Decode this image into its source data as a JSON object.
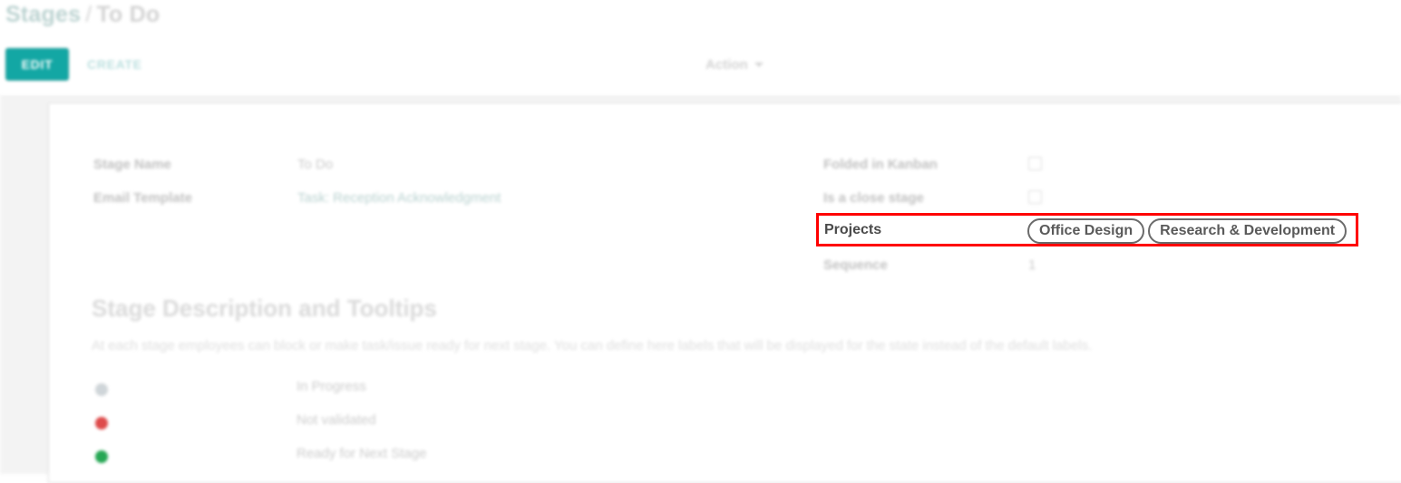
{
  "breadcrumb": {
    "root": "Stages",
    "separator": "/",
    "current": "To Do"
  },
  "control_panel": {
    "edit_label": "EDIT",
    "create_label": "CREATE",
    "action_label": "Action",
    "caret_icon": "chevron-down-icon"
  },
  "form": {
    "left_column": [
      {
        "label": "Stage Name",
        "value": "To Do",
        "style": "text"
      },
      {
        "label": "Email Template",
        "value": "Task: Reception Acknowledgment",
        "style": "link"
      }
    ],
    "right_column": [
      {
        "label": "Folded in Kanban",
        "value": "",
        "style": "checkbox",
        "checked": false
      },
      {
        "label": "Is a close stage",
        "value": "",
        "style": "checkbox",
        "checked": false
      },
      {
        "label": "Sequence",
        "value": "1",
        "style": "text"
      }
    ]
  },
  "highlighted_field": {
    "label": "Projects",
    "tags": [
      "Office Design",
      "Research & Development"
    ],
    "annotation_color": "#ff0000"
  },
  "section": {
    "title": "Stage Description and Tooltips",
    "description": "At each stage employees can block or make task/issue ready for next stage. You can define here labels that will be displayed for the state instead of the default labels.",
    "legend": [
      {
        "dot_color": "#ccd2d6",
        "dot_name": "grey-status-dot",
        "text": "In Progress"
      },
      {
        "dot_color": "#dc3c3c",
        "dot_name": "red-status-dot",
        "text": "Not validated"
      },
      {
        "dot_color": "#14a046",
        "dot_name": "green-status-dot",
        "text": "Ready for Next Stage"
      }
    ]
  },
  "theme": {
    "primary": "#00a09d",
    "link": "#b4cfcd",
    "muted_text": "#c6c6c6"
  }
}
